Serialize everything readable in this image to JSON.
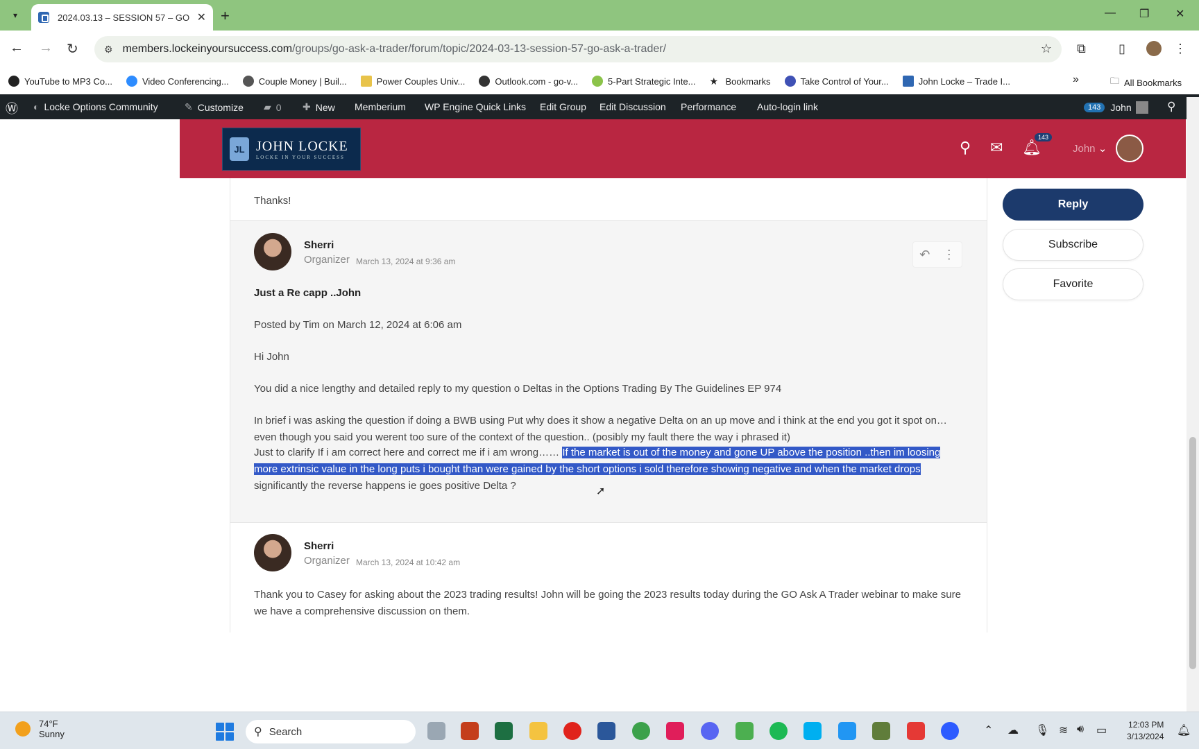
{
  "browser": {
    "tab_title": "2024.03.13 – SESSION 57 – GO",
    "url_host": "members.lockeinyoursuccess.com",
    "url_path": "/groups/go-ask-a-trader/forum/topic/2024-03-13-session-57-go-ask-a-trader/",
    "bookmarks": [
      {
        "label": "YouTube to MP3 Co...",
        "color": "#222222"
      },
      {
        "label": "Video Conferencing...",
        "color": "#2d8cff"
      },
      {
        "label": "Couple Money | Buil...",
        "color": "#555555"
      },
      {
        "label": "Power Couples Univ...",
        "color": "#e8c34a"
      },
      {
        "label": "Outlook.com - go-v...",
        "color": "#333333"
      },
      {
        "label": "5-Part Strategic Inte...",
        "color": "#8bc34a"
      },
      {
        "label": "Bookmarks",
        "color": "#222222"
      },
      {
        "label": "Take Control of Your...",
        "color": "#3f51b5"
      },
      {
        "label": "John Locke – Trade I...",
        "color": "#2f67b2"
      }
    ],
    "all_bookmarks": "All Bookmarks"
  },
  "wpbar": {
    "site": "Locke Options Community",
    "customize": "Customize",
    "comments": "0",
    "new": "New",
    "memberium": "Memberium",
    "wpengine": "WP Engine Quick Links",
    "edit_group": "Edit Group",
    "edit_discussion": "Edit Discussion",
    "performance": "Performance",
    "autologin": "Auto-login link",
    "count": "143",
    "user": "John"
  },
  "header": {
    "logo_name": "JOHN LOCKE",
    "logo_tagline": "LOCKE IN YOUR SUCCESS",
    "notif_count": "143",
    "user": "John"
  },
  "thread": {
    "thanks": "Thanks!",
    "reply1": {
      "author": "Sherri",
      "role": "Organizer",
      "date": "March 13, 2024 at 9:36 am",
      "heading": "Just a Re capp ..John",
      "posted_by": "Posted by Tim on March 12, 2024 at 6:06 am",
      "greeting": "Hi John",
      "para1": "You did a nice lengthy and detailed reply to my question o Deltas in the Options Trading By The Guidelines EP 974",
      "para2": "In brief i was asking the question if doing a BWB using Put why does it show a negative Delta on an up move and i think at the end you got it spot on…even though you said you werent too sure of the context of the question.. (posibly my fault there the way i phrased it)",
      "para3_pre": "Just to clarify If i am correct here and correct me if i am wrong…… ",
      "para3_highlight": "If the market is out of the money and gone UP above the position ..then im loosing more extrinsic value in the long puts i bought than were gained by the short options i sold therefore showing negative and when the market drops",
      "para3_post": " significantly the reverse happens ie goes positive Delta ?"
    },
    "reply2": {
      "author": "Sherri",
      "role": "Organizer",
      "date": "March 13, 2024 at 10:42 am",
      "body": "Thank you to Casey for asking about the 2023 trading results! John will be going the 2023 results today during the GO Ask A Trader webinar to make sure we have a comprehensive discussion on them."
    }
  },
  "sidebar": {
    "reply": "Reply",
    "subscribe": "Subscribe",
    "favorite": "Favorite"
  },
  "taskbar": {
    "temp": "74°F",
    "condition": "Sunny",
    "search": "Search",
    "time": "12:03 PM",
    "date": "3/13/2024"
  }
}
